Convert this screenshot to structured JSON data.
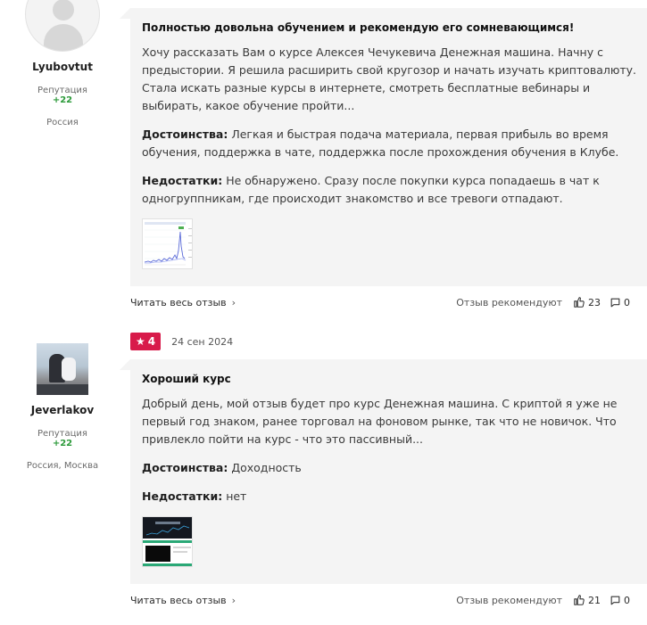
{
  "reviews": [
    {
      "user": {
        "name": "Lyubovtut",
        "reputation_label": "Репутация",
        "reputation_value": "+22",
        "location": "Россия"
      },
      "title": "Полностью довольна обучением и рекомендую его сомневающимся!",
      "text": "Хочу рассказать Вам о курсе Алексея Чечукевича Денежная машина. Начну с предыстории. Я решила расширить свой кругозор и начать изучать криптовалюту. Стала искать разные курсы в интернете, смотреть бесплатные вебинары и выбирать, какое обучение пройти...",
      "pros_label": "Достоинства:",
      "pros": "Легкая и быстрая подача материала, первая прибыль во время обучения, поддержка в чате, поддержка после прохождения обучения в Клубе.",
      "cons_label": "Недостатки:",
      "cons": "Не обнаружено. Сразу после покупки курса попадаешь в чат к одногруппникам, где происходит знакомство и все тревоги отпадают.",
      "read_more": "Читать весь отзыв",
      "recommends": "Отзыв рекомендуют",
      "likes": "23",
      "comments": "0"
    },
    {
      "rating": "4",
      "date": "24 сен 2024",
      "user": {
        "name": "Jeverlakov",
        "reputation_label": "Репутация",
        "reputation_value": "+22",
        "location": "Россия, Москва"
      },
      "title": "Хороший курс",
      "text": "Добрый день, мой отзыв будет про курс Денежная машина. С криптой я уже не первый год знаком, ранее торговал на фоновом рынке, так что не новичок. Что привлекло пойти на курс - что это пассивный...",
      "pros_label": "Достоинства:",
      "pros": "Доходность",
      "cons_label": "Недостатки:",
      "cons": "нет",
      "read_more": "Читать весь отзыв",
      "recommends": "Отзыв рекомендуют",
      "likes": "21",
      "comments": "0"
    }
  ],
  "colors": {
    "accent": "#d81b4a",
    "reputation": "#2c9a3a",
    "bubble_bg": "#f4f4f4"
  }
}
